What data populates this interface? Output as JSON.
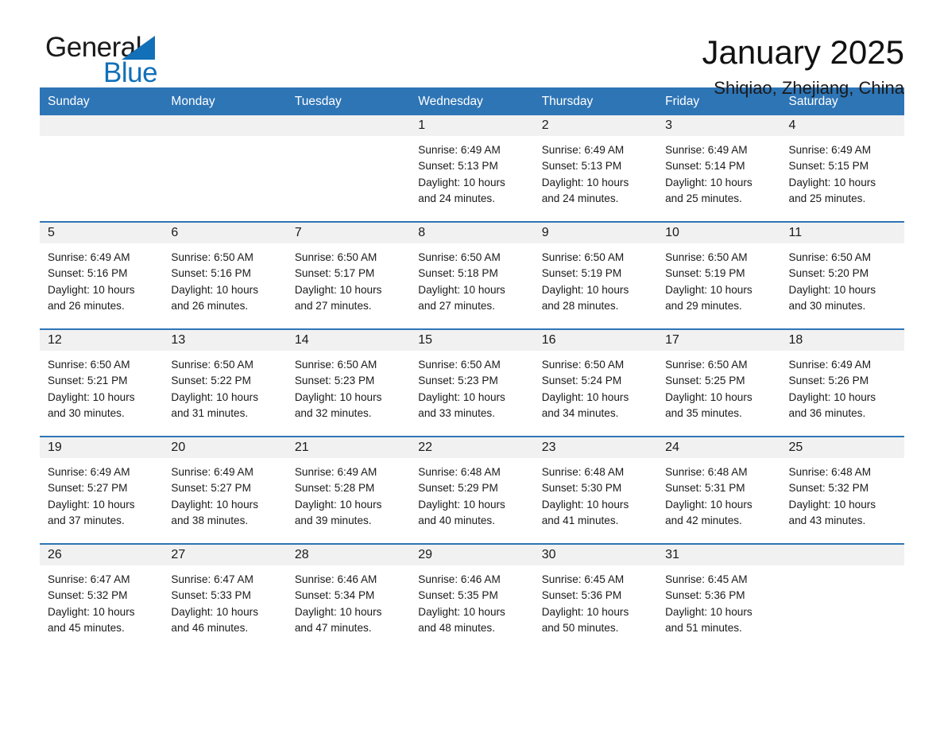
{
  "logo": {
    "word_dark": "General",
    "word_blue": "Blue",
    "triangle_color": "#1270b8"
  },
  "header": {
    "title": "January 2025",
    "location": "Shiqiao, Zhejiang, China"
  },
  "theme": {
    "header_blue": "#2e75b6",
    "daynum_gray": "#f1f1f1",
    "text": "#1a1a1a"
  },
  "labels": {
    "sunrise_prefix": "Sunrise: ",
    "sunset_prefix": "Sunset: ",
    "daylight_prefix": "Daylight: "
  },
  "weekdays": [
    "Sunday",
    "Monday",
    "Tuesday",
    "Wednesday",
    "Thursday",
    "Friday",
    "Saturday"
  ],
  "weeks": [
    [
      {
        "day": "",
        "sunrise": "",
        "sunset": "",
        "daylight_l1": "",
        "daylight_l2": ""
      },
      {
        "day": "",
        "sunrise": "",
        "sunset": "",
        "daylight_l1": "",
        "daylight_l2": ""
      },
      {
        "day": "",
        "sunrise": "",
        "sunset": "",
        "daylight_l1": "",
        "daylight_l2": ""
      },
      {
        "day": "1",
        "sunrise": "Sunrise: 6:49 AM",
        "sunset": "Sunset: 5:13 PM",
        "daylight_l1": "Daylight: 10 hours",
        "daylight_l2": "and 24 minutes."
      },
      {
        "day": "2",
        "sunrise": "Sunrise: 6:49 AM",
        "sunset": "Sunset: 5:13 PM",
        "daylight_l1": "Daylight: 10 hours",
        "daylight_l2": "and 24 minutes."
      },
      {
        "day": "3",
        "sunrise": "Sunrise: 6:49 AM",
        "sunset": "Sunset: 5:14 PM",
        "daylight_l1": "Daylight: 10 hours",
        "daylight_l2": "and 25 minutes."
      },
      {
        "day": "4",
        "sunrise": "Sunrise: 6:49 AM",
        "sunset": "Sunset: 5:15 PM",
        "daylight_l1": "Daylight: 10 hours",
        "daylight_l2": "and 25 minutes."
      }
    ],
    [
      {
        "day": "5",
        "sunrise": "Sunrise: 6:49 AM",
        "sunset": "Sunset: 5:16 PM",
        "daylight_l1": "Daylight: 10 hours",
        "daylight_l2": "and 26 minutes."
      },
      {
        "day": "6",
        "sunrise": "Sunrise: 6:50 AM",
        "sunset": "Sunset: 5:16 PM",
        "daylight_l1": "Daylight: 10 hours",
        "daylight_l2": "and 26 minutes."
      },
      {
        "day": "7",
        "sunrise": "Sunrise: 6:50 AM",
        "sunset": "Sunset: 5:17 PM",
        "daylight_l1": "Daylight: 10 hours",
        "daylight_l2": "and 27 minutes."
      },
      {
        "day": "8",
        "sunrise": "Sunrise: 6:50 AM",
        "sunset": "Sunset: 5:18 PM",
        "daylight_l1": "Daylight: 10 hours",
        "daylight_l2": "and 27 minutes."
      },
      {
        "day": "9",
        "sunrise": "Sunrise: 6:50 AM",
        "sunset": "Sunset: 5:19 PM",
        "daylight_l1": "Daylight: 10 hours",
        "daylight_l2": "and 28 minutes."
      },
      {
        "day": "10",
        "sunrise": "Sunrise: 6:50 AM",
        "sunset": "Sunset: 5:19 PM",
        "daylight_l1": "Daylight: 10 hours",
        "daylight_l2": "and 29 minutes."
      },
      {
        "day": "11",
        "sunrise": "Sunrise: 6:50 AM",
        "sunset": "Sunset: 5:20 PM",
        "daylight_l1": "Daylight: 10 hours",
        "daylight_l2": "and 30 minutes."
      }
    ],
    [
      {
        "day": "12",
        "sunrise": "Sunrise: 6:50 AM",
        "sunset": "Sunset: 5:21 PM",
        "daylight_l1": "Daylight: 10 hours",
        "daylight_l2": "and 30 minutes."
      },
      {
        "day": "13",
        "sunrise": "Sunrise: 6:50 AM",
        "sunset": "Sunset: 5:22 PM",
        "daylight_l1": "Daylight: 10 hours",
        "daylight_l2": "and 31 minutes."
      },
      {
        "day": "14",
        "sunrise": "Sunrise: 6:50 AM",
        "sunset": "Sunset: 5:23 PM",
        "daylight_l1": "Daylight: 10 hours",
        "daylight_l2": "and 32 minutes."
      },
      {
        "day": "15",
        "sunrise": "Sunrise: 6:50 AM",
        "sunset": "Sunset: 5:23 PM",
        "daylight_l1": "Daylight: 10 hours",
        "daylight_l2": "and 33 minutes."
      },
      {
        "day": "16",
        "sunrise": "Sunrise: 6:50 AM",
        "sunset": "Sunset: 5:24 PM",
        "daylight_l1": "Daylight: 10 hours",
        "daylight_l2": "and 34 minutes."
      },
      {
        "day": "17",
        "sunrise": "Sunrise: 6:50 AM",
        "sunset": "Sunset: 5:25 PM",
        "daylight_l1": "Daylight: 10 hours",
        "daylight_l2": "and 35 minutes."
      },
      {
        "day": "18",
        "sunrise": "Sunrise: 6:49 AM",
        "sunset": "Sunset: 5:26 PM",
        "daylight_l1": "Daylight: 10 hours",
        "daylight_l2": "and 36 minutes."
      }
    ],
    [
      {
        "day": "19",
        "sunrise": "Sunrise: 6:49 AM",
        "sunset": "Sunset: 5:27 PM",
        "daylight_l1": "Daylight: 10 hours",
        "daylight_l2": "and 37 minutes."
      },
      {
        "day": "20",
        "sunrise": "Sunrise: 6:49 AM",
        "sunset": "Sunset: 5:27 PM",
        "daylight_l1": "Daylight: 10 hours",
        "daylight_l2": "and 38 minutes."
      },
      {
        "day": "21",
        "sunrise": "Sunrise: 6:49 AM",
        "sunset": "Sunset: 5:28 PM",
        "daylight_l1": "Daylight: 10 hours",
        "daylight_l2": "and 39 minutes."
      },
      {
        "day": "22",
        "sunrise": "Sunrise: 6:48 AM",
        "sunset": "Sunset: 5:29 PM",
        "daylight_l1": "Daylight: 10 hours",
        "daylight_l2": "and 40 minutes."
      },
      {
        "day": "23",
        "sunrise": "Sunrise: 6:48 AM",
        "sunset": "Sunset: 5:30 PM",
        "daylight_l1": "Daylight: 10 hours",
        "daylight_l2": "and 41 minutes."
      },
      {
        "day": "24",
        "sunrise": "Sunrise: 6:48 AM",
        "sunset": "Sunset: 5:31 PM",
        "daylight_l1": "Daylight: 10 hours",
        "daylight_l2": "and 42 minutes."
      },
      {
        "day": "25",
        "sunrise": "Sunrise: 6:48 AM",
        "sunset": "Sunset: 5:32 PM",
        "daylight_l1": "Daylight: 10 hours",
        "daylight_l2": "and 43 minutes."
      }
    ],
    [
      {
        "day": "26",
        "sunrise": "Sunrise: 6:47 AM",
        "sunset": "Sunset: 5:32 PM",
        "daylight_l1": "Daylight: 10 hours",
        "daylight_l2": "and 45 minutes."
      },
      {
        "day": "27",
        "sunrise": "Sunrise: 6:47 AM",
        "sunset": "Sunset: 5:33 PM",
        "daylight_l1": "Daylight: 10 hours",
        "daylight_l2": "and 46 minutes."
      },
      {
        "day": "28",
        "sunrise": "Sunrise: 6:46 AM",
        "sunset": "Sunset: 5:34 PM",
        "daylight_l1": "Daylight: 10 hours",
        "daylight_l2": "and 47 minutes."
      },
      {
        "day": "29",
        "sunrise": "Sunrise: 6:46 AM",
        "sunset": "Sunset: 5:35 PM",
        "daylight_l1": "Daylight: 10 hours",
        "daylight_l2": "and 48 minutes."
      },
      {
        "day": "30",
        "sunrise": "Sunrise: 6:45 AM",
        "sunset": "Sunset: 5:36 PM",
        "daylight_l1": "Daylight: 10 hours",
        "daylight_l2": "and 50 minutes."
      },
      {
        "day": "31",
        "sunrise": "Sunrise: 6:45 AM",
        "sunset": "Sunset: 5:36 PM",
        "daylight_l1": "Daylight: 10 hours",
        "daylight_l2": "and 51 minutes."
      },
      {
        "day": "",
        "sunrise": "",
        "sunset": "",
        "daylight_l1": "",
        "daylight_l2": ""
      }
    ]
  ]
}
